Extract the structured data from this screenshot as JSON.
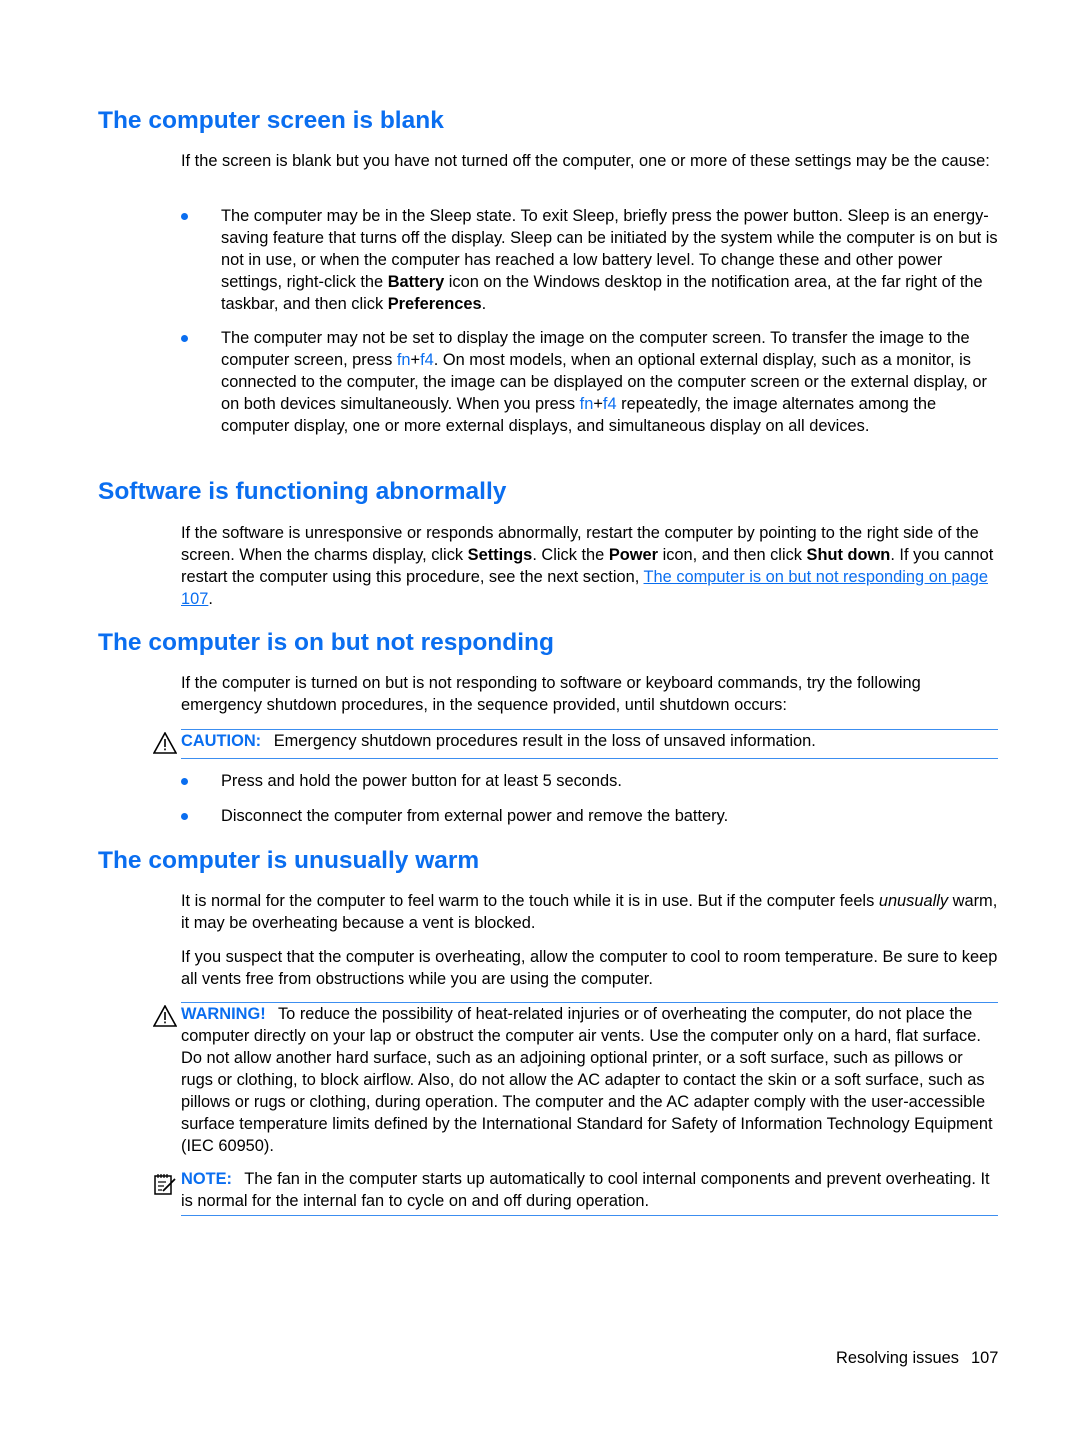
{
  "sections": {
    "blank": {
      "heading": "The computer screen is blank",
      "intro": "If the screen is blank but you have not turned off the computer, one or more of these settings may be the cause:",
      "bullet1": {
        "t1": "The computer may be in the Sleep state. To exit Sleep, briefly press the power button. Sleep is an energy-saving feature that turns off the display. Sleep can be initiated by the system while the computer is on but is not in use, or when the computer has reached a low battery level. To change these and other power settings, right-click the ",
        "b1": "Battery",
        "t2": " icon on the Windows desktop in the notification area, at the far right of the taskbar, and then click ",
        "b2": "Preferences",
        "t3": "."
      },
      "bullet2": {
        "t1": "The computer may not be set to display the image on the computer screen. To transfer the image to the computer screen, press ",
        "k1a": "fn",
        "plus": "+",
        "k1b": "f4",
        "t2": ". On most models, when an optional external display, such as a monitor, is connected to the computer, the image can be displayed on the computer screen or the external display, or on both devices simultaneously. When you press ",
        "k2a": "fn",
        "k2b": "f4",
        "t3": " repeatedly, the image alternates among the computer display, one or more external displays, and simultaneous display on all devices."
      }
    },
    "software": {
      "heading": "Software is functioning abnormally",
      "t1": "If the software is unresponsive or responds abnormally, restart the computer by pointing to the right side of the screen. When the charms display, click ",
      "b1": "Settings",
      "t2": ". Click the ",
      "b2": "Power",
      "t3": " icon, and then click ",
      "b3": "Shut down",
      "t4": ". If you cannot restart the computer using this procedure, see the next section, ",
      "link": "The computer is on but not responding on page 107",
      "t5": "."
    },
    "not_responding": {
      "heading": "The computer is on but not responding",
      "intro": "If the computer is turned on but is not responding to software or keyboard commands, try the following emergency shutdown procedures, in the sequence provided, until shutdown occurs:",
      "caution_label": "CAUTION:",
      "caution_text": "Emergency shutdown procedures result in the loss of unsaved information.",
      "bullets": [
        "Press and hold the power button for at least 5 seconds.",
        "Disconnect the computer from external power and remove the battery."
      ]
    },
    "warm": {
      "heading": "The computer is unusually warm",
      "p1a": "It is normal for the computer to feel warm to the touch while it is in use. But if the computer feels ",
      "p1i": "unusually",
      "p1b": " warm, it may be overheating because a vent is blocked.",
      "p2": "If you suspect that the computer is overheating, allow the computer to cool to room temperature. Be sure to keep all vents free from obstructions while you are using the computer.",
      "warning_label": "WARNING!",
      "warning_text": "To reduce the possibility of heat-related injuries or of overheating the computer, do not place the computer directly on your lap or obstruct the computer air vents. Use the computer only on a hard, flat surface. Do not allow another hard surface, such as an adjoining optional printer, or a soft surface, such as pillows or rugs or clothing, to block airflow. Also, do not allow the AC adapter to contact the skin or a soft surface, such as pillows or rugs or clothing, during operation. The computer and the AC adapter comply with the user-accessible surface temperature limits defined by the International Standard for Safety of Information Technology Equipment (IEC 60950).",
      "note_label": "NOTE:",
      "note_text": "The fan in the computer starts up automatically to cool internal components and prevent overheating. It is normal for the internal fan to cycle on and off during operation."
    }
  },
  "footer": {
    "section": "Resolving issues",
    "page": "107"
  },
  "colors": {
    "accent": "#0a6ef0",
    "rule": "#3c8ef0"
  },
  "icons": {
    "caution": "warning-triangle-icon",
    "warning": "warning-triangle-icon",
    "note": "note-pad-icon",
    "bullet": "bullet-dot-icon"
  }
}
